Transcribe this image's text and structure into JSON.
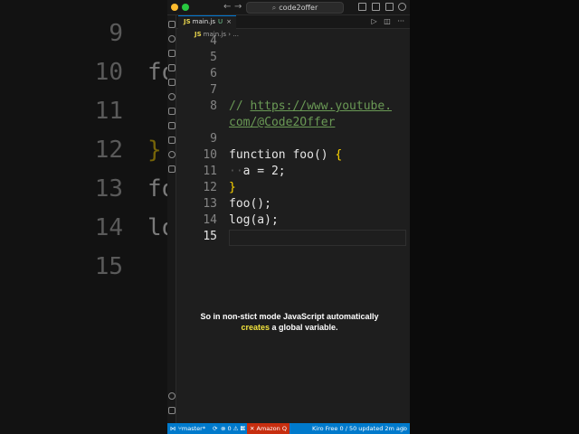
{
  "background": {
    "line_numbers": [
      "9",
      "10",
      "11",
      "12",
      "13",
      "14",
      "15"
    ],
    "code_fragments": [
      "fo",
      "}",
      "fo",
      "lo"
    ]
  },
  "titlebar": {
    "search_text": "code2offer"
  },
  "tab": {
    "filename": "main.js",
    "icon_text": "JS",
    "status": "U"
  },
  "breadcrumb": {
    "file": "main.js",
    "rest": "..."
  },
  "editor": {
    "lines": [
      {
        "num": "4",
        "text": ""
      },
      {
        "num": "5",
        "text": ""
      },
      {
        "num": "6",
        "text": ""
      },
      {
        "num": "7",
        "text": ""
      },
      {
        "num": "8",
        "text": "// https://www.youtube."
      },
      {
        "num": "",
        "text": "com/@Code2Offer"
      },
      {
        "num": "9",
        "text": ""
      },
      {
        "num": "10",
        "text": "function foo() {"
      },
      {
        "num": "11",
        "text": "  a = 2;"
      },
      {
        "num": "12",
        "text": "}"
      },
      {
        "num": "13",
        "text": "foo();"
      },
      {
        "num": "14",
        "text": "log(a);"
      },
      {
        "num": "15",
        "text": ""
      }
    ],
    "comment_prefix": "// ",
    "link_part1": "https://www.youtube.",
    "link_part2": "com/@Code2Offer",
    "kw_function": "function",
    "fn_name": " foo",
    "parens": "()",
    "space": " ",
    "brace_open": "{",
    "brace_close": "}",
    "indent_dots": "··",
    "assign": "a = 2;",
    "call": "foo();",
    "log": "log(a);"
  },
  "caption": {
    "line1": "So in non-stict mode JavaScript automatically",
    "highlight": "creates",
    "line2_rest": " a global variable."
  },
  "statusbar": {
    "branch": "master*",
    "problems": "⊗ 0 ⚠ 0",
    "amazon": "✕ Amazon Q",
    "kiro": "Kiro Free 0 / 50 updated 2m ago"
  },
  "colors": {
    "accent": "#007acc",
    "highlight": "#f2e33d",
    "comment": "#6a9955",
    "brace": "#ffd700"
  }
}
